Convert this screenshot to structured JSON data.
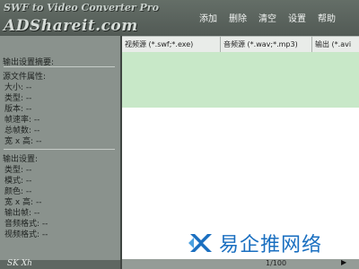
{
  "app": {
    "logo_line1": "SWF to Video Converter Pro",
    "logo_line2": "ADShareit.com"
  },
  "menu": [
    "添加",
    "删除",
    "清空",
    "设置",
    "帮助"
  ],
  "left_panel": {
    "title": "输出设置摘要:",
    "source_section": "源文件属性:",
    "source_rows": [
      "大小: --",
      "类型: --",
      "版本: --",
      "帧速率: --",
      "总帧数: --",
      "宽 x 高: --"
    ],
    "output_section": "输出设置:",
    "output_rows": [
      "类型: --",
      "模式: --",
      "颜色: --",
      "宽 x 高: --",
      "输出帧: --",
      "音频格式: --",
      "视频格式: --"
    ],
    "footer_text": "SK  Xh"
  },
  "table": {
    "columns": [
      "视频源 (*.swf;*.exe)",
      "音频源 (*.wav;*.mp3)",
      "输出 (*.avi"
    ]
  },
  "status": {
    "page": "1/100",
    "arrow": "▶"
  },
  "watermark": {
    "text": "易企推网络",
    "accent_color": "#1a6fc0"
  },
  "colors": {
    "list_highlight": "#c8e8c8",
    "panel_bg": "#8a928d",
    "header_bg": "#5c655f"
  }
}
